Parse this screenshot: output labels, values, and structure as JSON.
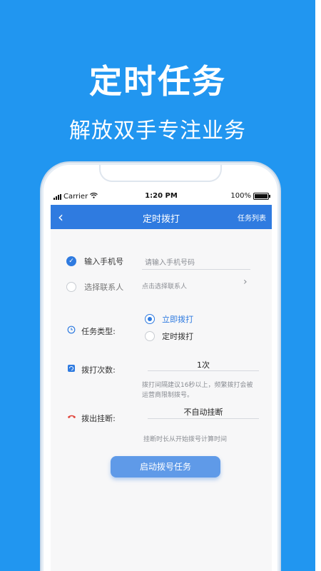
{
  "promo": {
    "title": "定时任务",
    "subtitle": "解放双手专注业务"
  },
  "status_bar": {
    "carrier": "Carrier",
    "time": "1:20 PM",
    "battery": "100%",
    "battery_level": 1.0
  },
  "nav": {
    "back_icon": "‹",
    "title": "定时拨打",
    "right_label": "任务列表"
  },
  "contact_options": {
    "phone": {
      "label": "输入手机号",
      "placeholder": "请输入手机号码",
      "selected": true
    },
    "contact": {
      "label": "选择联系人",
      "placeholder": "点击选择联系人",
      "chevron": "›",
      "selected": false
    }
  },
  "task_type": {
    "label": "任务类型:",
    "options": [
      {
        "label": "立即拨打",
        "selected": true
      },
      {
        "label": "定时拨打",
        "selected": false
      }
    ]
  },
  "dial_count": {
    "label": "拨打次数:",
    "value": "1次",
    "hint_line1": "拨打间隔建议16秒以上，频繁拨打会被",
    "hint_line2": "运营商限制拨号。"
  },
  "hangup": {
    "label": "拨出挂断:",
    "value": "不自动挂断",
    "hint": "挂断时长从开始拨号计算时间"
  },
  "submit": {
    "label": "启动拨号任务"
  },
  "colors": {
    "background": "#2196f0",
    "nav_blue": "#2f7be0",
    "button_blue": "#5f9ae8",
    "hangup_red": "#e0443a"
  }
}
